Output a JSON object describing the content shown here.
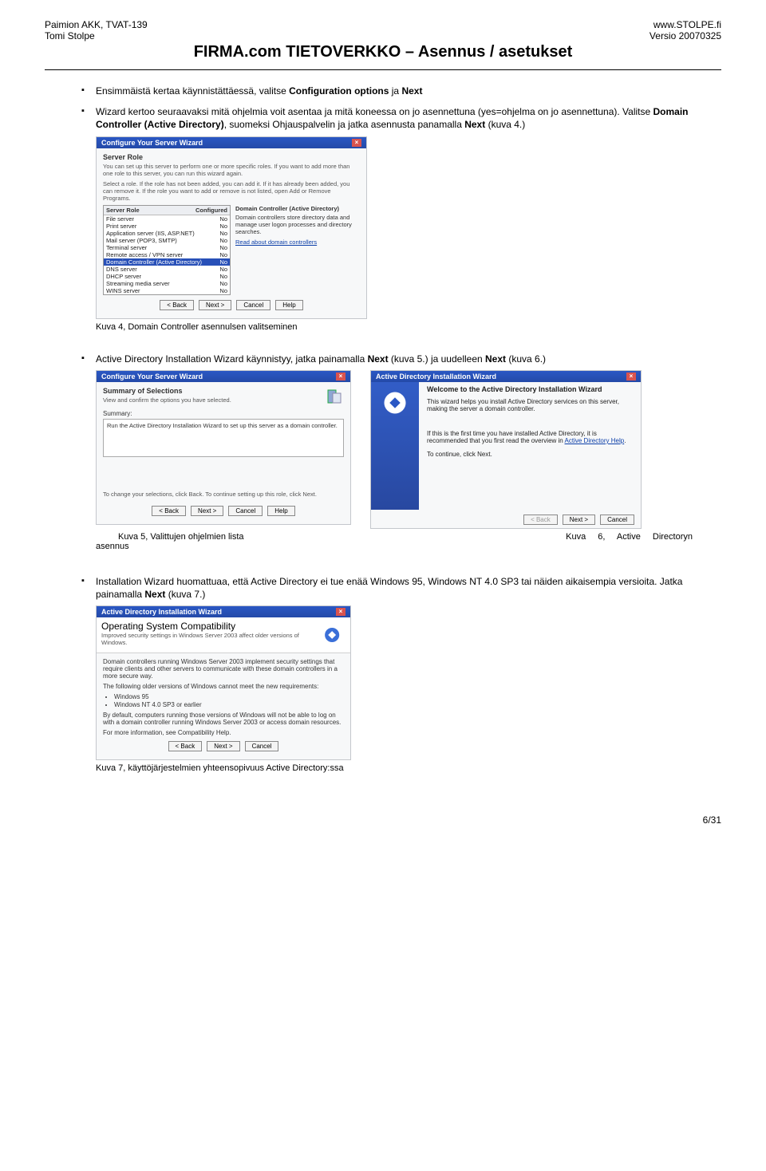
{
  "header": {
    "left1": "Paimion AKK, TVAT-139",
    "left2": "Tomi Stolpe",
    "right1": "www.STOLPE.fi",
    "right2": "Versio 20070325"
  },
  "title": "FIRMA.com TIETOVERKKO – Asennus / asetukset",
  "bullets": {
    "b1_a": "Ensimmäistä kertaa käynnistättäessä, valitse ",
    "b1_bold1": "Configuration options",
    "b1_mid": " ja ",
    "b1_bold2": "Next",
    "b2_a": "Wizard kertoo seuraavaksi mitä ohjelmia voit asentaa ja mitä koneessa on jo asennettuna (yes=ohjelma on jo asennettuna). Valitse ",
    "b2_bold1": "Domain Controller (Active Directory)",
    "b2_mid": ", suomeksi Ohjauspalvelin ja jatka asennusta panamalla ",
    "b2_bold2": "Next",
    "b2_end": " (kuva 4.)",
    "b3_a": "Active Directory Installation Wizard käynnistyy, jatka painamalla ",
    "b3_bold1": "Next",
    "b3_mid": " (kuva 5.) ja uudelleen ",
    "b3_bold2": "Next",
    "b3_end": " (kuva 6.)",
    "b4_a": "Installation Wizard huomattuaa, että Active Directory ei tue enää Windows 95, Windows NT 4.0 SP3 tai näiden aikaisempia versioita. Jatka painamalla ",
    "b4_bold1": "Next",
    "b4_end": " (kuva 7.)"
  },
  "captions": {
    "c4": "Kuva 4, Domain Controller asennulsen valitseminen",
    "c5": "Kuva 5, Valittujen ohjelmien lista",
    "c5b": "asennus",
    "c6": "Kuva 6, Active Directoryn",
    "c7": "Kuva 7, käyttöjärjestelmien yhteensopivuus Active Directory:ssa"
  },
  "wiz": {
    "csw_title": "Configure Your Server Wizard",
    "server_role": "Server Role",
    "server_role_sub": "You can set up this server to perform one or more specific roles. If you want to add more than one role to this server, you can run this wizard again.",
    "server_role_sel": "Select a role. If the role has not been added, you can add it. If it has already been added, you can remove it. If the role you want to add or remove is not listed, open Add or Remove Programs.",
    "th1": "Server Role",
    "th2": "Configured",
    "roles": [
      {
        "name": "File server",
        "cfg": "No"
      },
      {
        "name": "Print server",
        "cfg": "No"
      },
      {
        "name": "Application server (IIS, ASP.NET)",
        "cfg": "No"
      },
      {
        "name": "Mail server (POP3, SMTP)",
        "cfg": "No"
      },
      {
        "name": "Terminal server",
        "cfg": "No"
      },
      {
        "name": "Remote access / VPN server",
        "cfg": "No"
      },
      {
        "name": "Domain Controller (Active Directory)",
        "cfg": "No"
      },
      {
        "name": "DNS server",
        "cfg": "No"
      },
      {
        "name": "DHCP server",
        "cfg": "No"
      },
      {
        "name": "Streaming media server",
        "cfg": "No"
      },
      {
        "name": "WINS server",
        "cfg": "No"
      }
    ],
    "ri_head": "Domain Controller (Active Directory)",
    "ri_body": "Domain controllers store directory data and manage user logon processes and directory searches.",
    "ri_link": "Read about domain controllers",
    "btn_back": "< Back",
    "btn_next": "Next >",
    "btn_cancel": "Cancel",
    "btn_help": "Help",
    "sum_title": "Configure Your Server Wizard",
    "sum_head": "Summary of Selections",
    "sum_sub": "View and confirm the options you have selected.",
    "sum_label": "Summary:",
    "sum_line": "Run the Active Directory Installation Wizard to set up this server as a domain controller.",
    "sum_foot": "To change your selections, click Back. To continue setting up this role, click Next.",
    "ad_title": "Active Directory Installation Wizard",
    "ad_welcome": "Welcome to the Active Directory Installation Wizard",
    "ad_body1": "This wizard helps you install Active Directory services on this server, making the server a domain controller.",
    "ad_body2a": "If this is the first time you have installed Active Directory, it is recommended that you first read the overview in ",
    "ad_body2_link": "Active Directory Help",
    "ad_body3": "To continue, click Next.",
    "os_title": "Active Directory Installation Wizard",
    "os_head": "Operating System Compatibility",
    "os_sub": "Improved security settings in Windows Server 2003 affect older versions of Windows.",
    "os_p1": "Domain controllers running Windows Server 2003 implement security settings that require clients and other servers to communicate with these domain controllers in a more secure way.",
    "os_p2": "The following older versions of Windows cannot meet the new requirements:",
    "os_li1": "Windows 95",
    "os_li2": "Windows NT 4.0 SP3 or earlier",
    "os_p3": "By default, computers running those versions of Windows will not be able to log on with a domain controller running Windows Server 2003 or access domain resources.",
    "os_p4a": "For more information, see ",
    "os_p4_link": "Compatibility Help"
  },
  "footer": "6/31"
}
